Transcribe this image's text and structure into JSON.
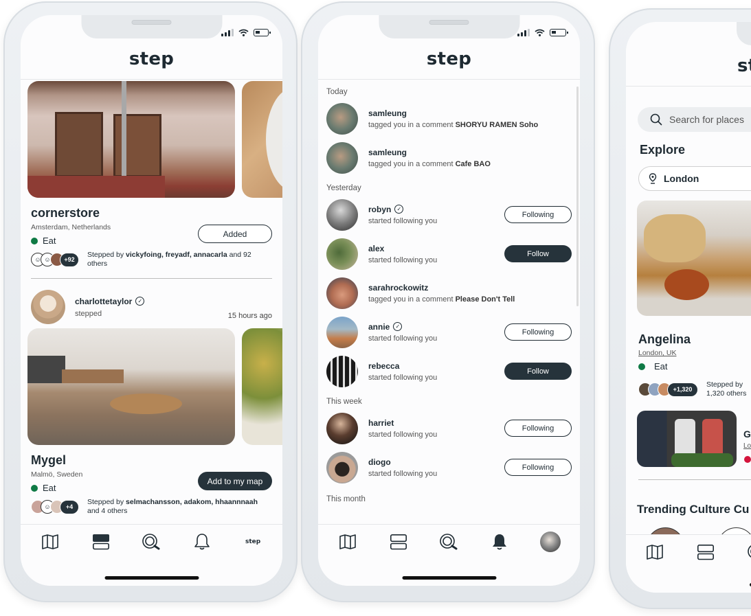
{
  "app": {
    "brand": "step"
  },
  "feed_phone": {
    "places": [
      {
        "name": "cornerstore",
        "location": "Amsterdam, Netherlands",
        "category": "Eat",
        "category_color": "#0f7a45",
        "action_label": "Added",
        "action_style": "outline",
        "stepped_prefix": "Stepped by ",
        "stepped_users": "vickyfoing, freyadf, annacarla",
        "stepped_suffix": " and 92 others",
        "extra_count": "+92"
      },
      {
        "name": "Mygel",
        "location": "Malmö, Sweden",
        "category": "Eat",
        "category_color": "#0f7a45",
        "action_label": "Add to my map",
        "action_style": "solid",
        "stepped_prefix": "Stepped by ",
        "stepped_users": "selmachansson, adakom, hhaannnaah",
        "stepped_suffix": " and 4 others",
        "extra_count": "+4"
      }
    ],
    "poster": {
      "username": "charlottetaylor",
      "action": "stepped",
      "time_ago": "15 hours ago"
    },
    "tabs": [
      {
        "name": "map",
        "icon": "map-icon"
      },
      {
        "name": "feed",
        "icon": "feed-icon",
        "active": true
      },
      {
        "name": "search",
        "icon": "search-icon"
      },
      {
        "name": "notifications",
        "icon": "bell-icon"
      },
      {
        "name": "profile",
        "label": "step"
      }
    ]
  },
  "notifications_phone": {
    "sections": [
      {
        "title": "Today",
        "items": [
          {
            "user": "samleung",
            "text": "tagged you in a comment ",
            "bold": "SHORYU RAMEN Soho",
            "verified": false,
            "button": null
          },
          {
            "user": "samleung",
            "text": "tagged you in a comment ",
            "bold": "Cafe BAO",
            "verified": false,
            "button": null
          }
        ]
      },
      {
        "title": "Yesterday",
        "items": [
          {
            "user": "robyn",
            "text": "started following you",
            "bold": "",
            "verified": true,
            "button": "Following"
          },
          {
            "user": "alex",
            "text": "started following you",
            "bold": "",
            "verified": false,
            "button": "Follow"
          },
          {
            "user": "sarahrockowitz",
            "text": "tagged you in a comment ",
            "bold": "Please Don't Tell",
            "verified": false,
            "button": null
          },
          {
            "user": "annie",
            "text": "started following you",
            "bold": "",
            "verified": true,
            "button": "Following"
          },
          {
            "user": "rebecca",
            "text": "started following you",
            "bold": "",
            "verified": false,
            "button": "Follow"
          }
        ]
      },
      {
        "title": "This week",
        "items": [
          {
            "user": "harriet",
            "text": "started following you",
            "bold": "",
            "verified": false,
            "button": "Following"
          },
          {
            "user": "diogo",
            "text": "started following you",
            "bold": "",
            "verified": false,
            "button": "Following"
          }
        ]
      },
      {
        "title": "This month",
        "items": []
      }
    ]
  },
  "explore_phone": {
    "search_placeholder": "Search for places",
    "heading": "Explore",
    "location": "London",
    "featured": {
      "name": "Angelina",
      "location": "London, UK",
      "category": "Eat",
      "category_color": "#0f7a45",
      "extra_count": "+1,320",
      "stepped_text": "Stepped by",
      "stepped_text2": "1,320 others"
    },
    "second_item": {
      "name_initial": "G",
      "location_initial": "Lo",
      "category_color": "#d4143c"
    },
    "trending_heading": "Trending Culture Cu"
  }
}
